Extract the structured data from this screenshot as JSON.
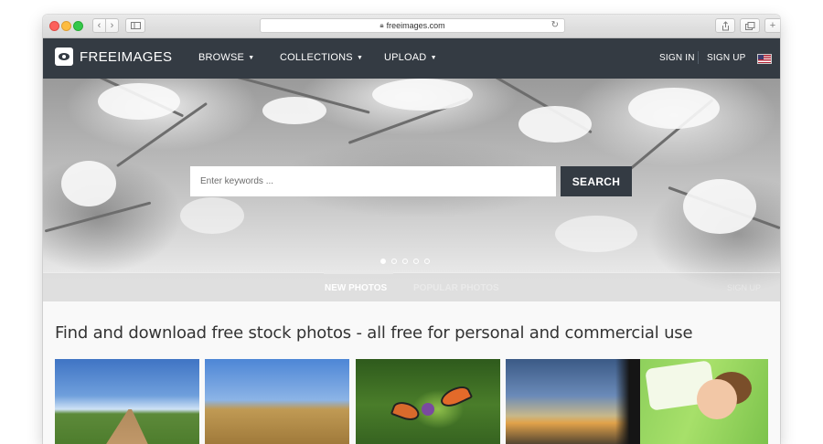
{
  "browser": {
    "url": "freeimages.com"
  },
  "nav": {
    "logo_text": "FREEIMAGES",
    "browse_label": "BROWSE",
    "collections_label": "COLLECTIONS",
    "upload_label": "UPLOAD",
    "sign_in_label": "SIGN IN",
    "sign_up_label": "SIGN UP"
  },
  "hero": {
    "search_placeholder": "Enter keywords ...",
    "search_button_label": "SEARCH",
    "slide_count": 5,
    "active_slide": 1,
    "tabs": [
      {
        "label": "NEW PHOTOS",
        "active": true
      },
      {
        "label": "POPULAR PHOTOS",
        "active": false
      }
    ],
    "tab_right_label": "SIGN UP"
  },
  "content": {
    "headline": "Find and download free stock photos - all free for personal and commercial use",
    "thumbnails": [
      {
        "subject": "country road landscape"
      },
      {
        "subject": "wheat field"
      },
      {
        "subject": "butterfly on flower"
      },
      {
        "subject": "sunset sky"
      },
      {
        "subject": "sleeping child"
      }
    ]
  },
  "colors": {
    "navbar": "#343b43",
    "search_button": "#343b43",
    "traffic_red": "#fc605b",
    "traffic_yellow": "#fdbc40",
    "traffic_green": "#34c84a"
  }
}
